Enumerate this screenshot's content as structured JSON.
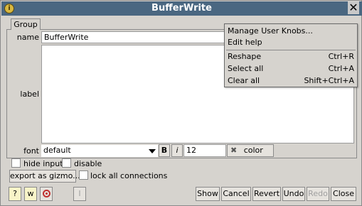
{
  "window": {
    "title": "BufferWrite",
    "app_icon": "nuke-icon",
    "close_glyph": "✕"
  },
  "tab": {
    "label": "Group"
  },
  "fields": {
    "name_label": "name",
    "name_value": "BufferWrite",
    "label_label": "label",
    "label_value": "",
    "font_label": "font",
    "font_value": "default",
    "bold_label": "B",
    "italic_label": "i",
    "size_value": "12",
    "color_label": "color",
    "color_icon": "✖"
  },
  "options": {
    "hide_input": "hide input",
    "disable": "disable",
    "export_gizmo": "export as gizmo...",
    "lock_connections": "lock all connections"
  },
  "bottom": {
    "help_label": "?",
    "w_label": "w",
    "target_icon": "target-icon",
    "i_label": "I",
    "show": "Show",
    "cancel": "Cancel",
    "revert": "Revert",
    "undo": "Undo",
    "redo": "Redo",
    "close": "Close"
  },
  "context_menu": {
    "items": [
      {
        "label": "Manage User Knobs...",
        "shortcut": ""
      },
      {
        "label": "Edit help",
        "shortcut": ""
      },
      {
        "label": "Reshape",
        "shortcut": "Ctrl+R"
      },
      {
        "label": "Select all",
        "shortcut": "Ctrl+A"
      },
      {
        "label": "Clear all",
        "shortcut": "Shift+Ctrl+A"
      }
    ]
  },
  "colors": {
    "titlebar": "#4a6781",
    "background": "#d6d3ce"
  }
}
